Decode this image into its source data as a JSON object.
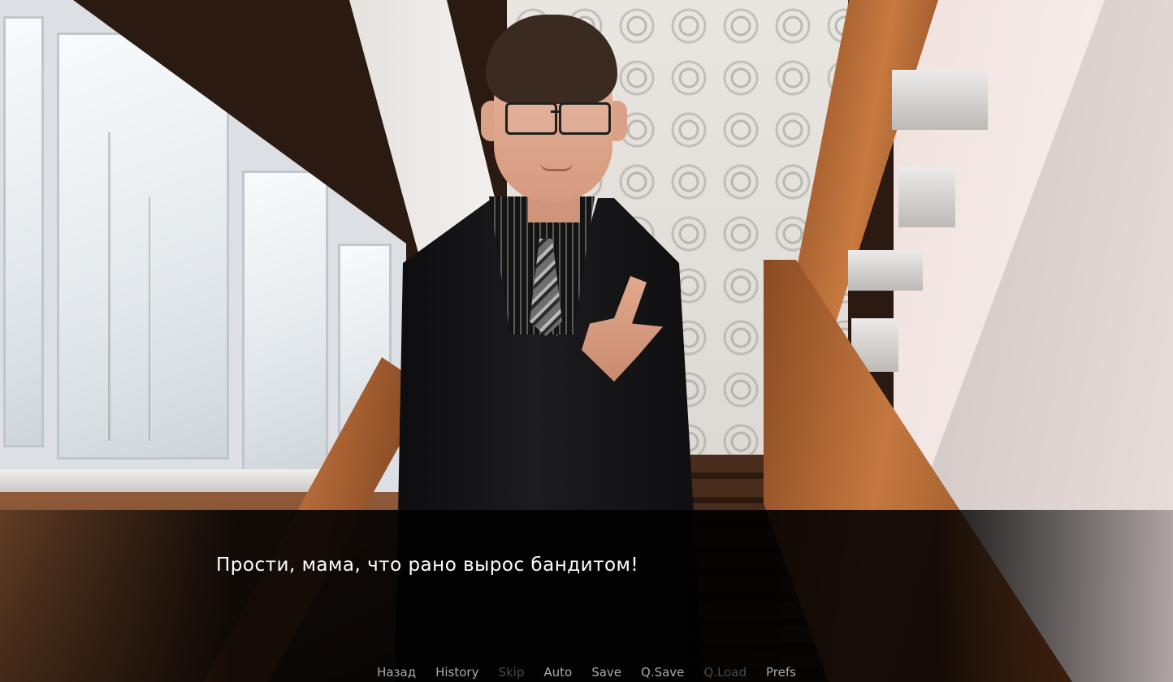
{
  "dialogue": {
    "text": "Прости, мама, что рано вырос бандитом!"
  },
  "quick_menu": {
    "items": [
      {
        "label": "Назад",
        "enabled": true
      },
      {
        "label": "History",
        "enabled": true
      },
      {
        "label": "Skip",
        "enabled": false
      },
      {
        "label": "Auto",
        "enabled": true
      },
      {
        "label": "Save",
        "enabled": true
      },
      {
        "label": "Q.Save",
        "enabled": true
      },
      {
        "label": "Q.Load",
        "enabled": false
      },
      {
        "label": "Prefs",
        "enabled": true
      }
    ]
  },
  "colors": {
    "dialogue_text": "#ffffff",
    "menu_enabled": "#a9a9a9",
    "menu_disabled": "#4a4a4a"
  }
}
